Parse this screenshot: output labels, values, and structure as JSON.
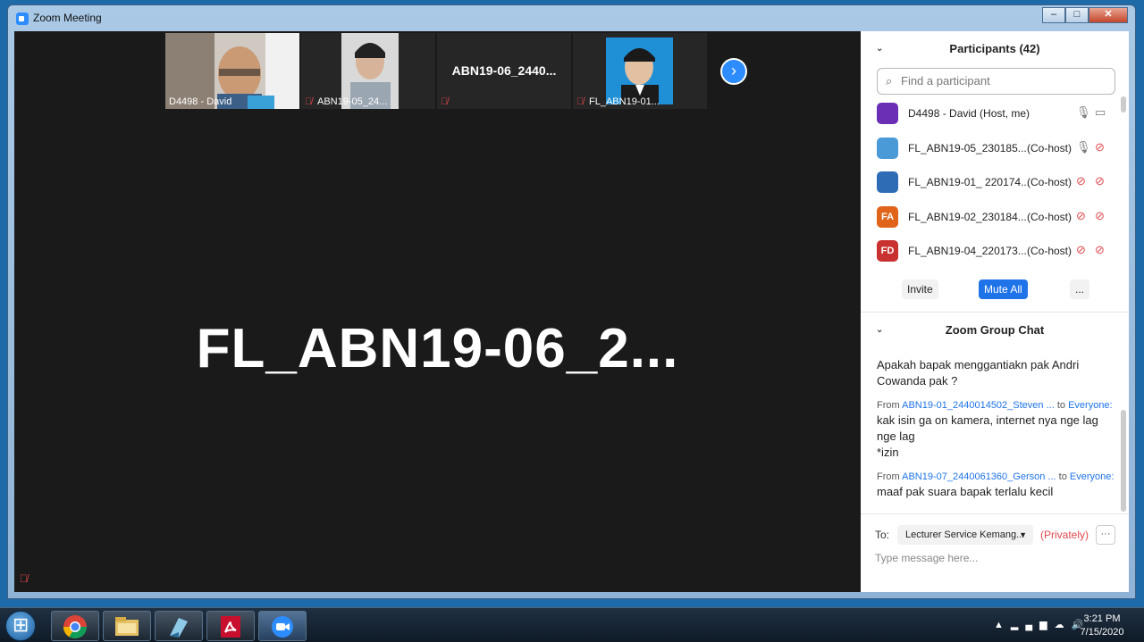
{
  "window": {
    "title": "Zoom Meeting"
  },
  "thumbnails": [
    {
      "name": "D4498 - David",
      "muted": false,
      "type": "video"
    },
    {
      "name": "ABN19-05_24...",
      "muted": true,
      "type": "video"
    },
    {
      "name": "",
      "display_name": "ABN19-06_2440...",
      "muted": true,
      "type": "name-only"
    },
    {
      "name": "FL_ABN19-01...",
      "muted": true,
      "type": "video"
    }
  ],
  "main_speaker": {
    "name": "FL_ABN19-06_2..."
  },
  "participants_panel": {
    "title": "Participants (42)",
    "search_placeholder": "Find a participant",
    "items": [
      {
        "name": "D4498 - David (Host, me)",
        "role": "",
        "avatar": "",
        "avatar_color": "#6a2fb5",
        "mic": "on",
        "cam": "on"
      },
      {
        "name": "FL_ABN19-05_230185...",
        "role": "(Co-host)",
        "avatar": "",
        "avatar_color": "#4a9ad8",
        "mic": "on",
        "cam": "off"
      },
      {
        "name": "FL_ABN19-01_ 220174...",
        "role": "(Co-host)",
        "avatar": "",
        "avatar_color": "#2e6db5",
        "mic": "muted",
        "cam": "off"
      },
      {
        "name": "FL_ABN19-02_230184...",
        "role": "(Co-host)",
        "avatar": "FA",
        "avatar_color": "#e0651a",
        "mic": "muted",
        "cam": "off"
      },
      {
        "name": "FL_ABN19-04_220173...",
        "role": "(Co-host)",
        "avatar": "FD",
        "avatar_color": "#c93030",
        "mic": "muted",
        "cam": "off"
      }
    ],
    "invite_label": "Invite",
    "mute_all_label": "Mute All",
    "more_label": "..."
  },
  "chat": {
    "title": "Zoom Group Chat",
    "messages": [
      {
        "from": "",
        "to": "",
        "text": "Apakah bapak menggantiakn pak Andri Cowanda pak ?"
      },
      {
        "from": "ABN19-01_2440014502_Steven ...",
        "to": "Everyone:",
        "text": "kak isin ga on kamera, internet nya nge lag nge lag\n*izin"
      },
      {
        "from": "ABN19-07_2440061360_Gerson ...",
        "to": "Everyone:",
        "text": "maaf pak suara bapak terlalu kecil"
      }
    ],
    "from_label": "From",
    "to_label_inline": "to",
    "to_label": "To:",
    "recipient": "Lecturer Service Kemang...",
    "privately": "(Privately)",
    "more": "···",
    "input_placeholder": "Type message here..."
  },
  "taskbar": {
    "apps": [
      "chrome",
      "file-explorer",
      "notepad",
      "acrobat",
      "zoom"
    ],
    "time": "3:21 PM",
    "date": "7/15/2020"
  }
}
